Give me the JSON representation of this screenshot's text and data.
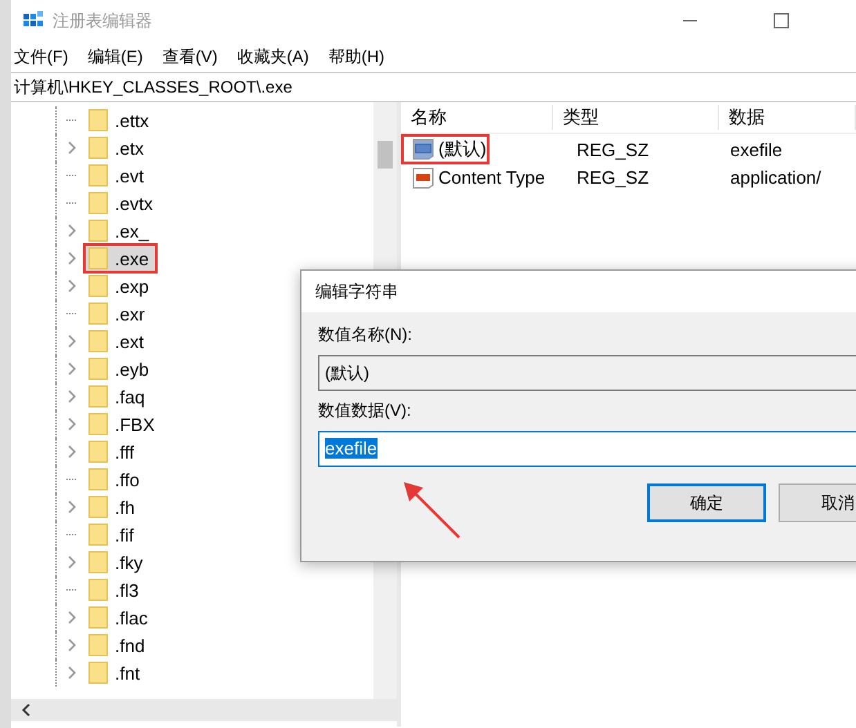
{
  "window": {
    "title": "注册表编辑器",
    "active": false
  },
  "menu": [
    "文件(F)",
    "编辑(E)",
    "查看(V)",
    "收藏夹(A)",
    "帮助(H)"
  ],
  "address": "计算机\\HKEY_CLASSES_ROOT\\.exe",
  "tree": [
    {
      "label": ".ettx",
      "expandable": false,
      "selected": false,
      "marked": false
    },
    {
      "label": ".etx",
      "expandable": true,
      "selected": false,
      "marked": false
    },
    {
      "label": ".evt",
      "expandable": false,
      "selected": false,
      "marked": false
    },
    {
      "label": ".evtx",
      "expandable": false,
      "selected": false,
      "marked": false
    },
    {
      "label": ".ex_",
      "expandable": true,
      "selected": false,
      "marked": false
    },
    {
      "label": ".exe",
      "expandable": true,
      "selected": true,
      "marked": true
    },
    {
      "label": ".exp",
      "expandable": true,
      "selected": false,
      "marked": false
    },
    {
      "label": ".exr",
      "expandable": false,
      "selected": false,
      "marked": false
    },
    {
      "label": ".ext",
      "expandable": true,
      "selected": false,
      "marked": false
    },
    {
      "label": ".eyb",
      "expandable": true,
      "selected": false,
      "marked": false
    },
    {
      "label": ".faq",
      "expandable": true,
      "selected": false,
      "marked": false
    },
    {
      "label": ".FBX",
      "expandable": true,
      "selected": false,
      "marked": false
    },
    {
      "label": ".fff",
      "expandable": true,
      "selected": false,
      "marked": false
    },
    {
      "label": ".ffo",
      "expandable": false,
      "selected": false,
      "marked": false
    },
    {
      "label": ".fh",
      "expandable": true,
      "selected": false,
      "marked": false
    },
    {
      "label": ".fif",
      "expandable": false,
      "selected": false,
      "marked": false
    },
    {
      "label": ".fky",
      "expandable": true,
      "selected": false,
      "marked": false
    },
    {
      "label": ".fl3",
      "expandable": false,
      "selected": false,
      "marked": false
    },
    {
      "label": ".flac",
      "expandable": true,
      "selected": false,
      "marked": false
    },
    {
      "label": ".fnd",
      "expandable": true,
      "selected": false,
      "marked": false
    },
    {
      "label": ".fnt",
      "expandable": true,
      "selected": false,
      "marked": false
    }
  ],
  "values": {
    "columns": [
      "名称",
      "类型",
      "数据"
    ],
    "rows": [
      {
        "name": "(默认)",
        "type": "REG_SZ",
        "data": "exefile",
        "marked": true
      },
      {
        "name": "Content Type",
        "type": "REG_SZ",
        "data": "application/",
        "marked": false
      }
    ]
  },
  "dialog": {
    "title": "编辑字符串",
    "name_label": "数值名称(N):",
    "name_value": "(默认)",
    "data_label": "数值数据(V):",
    "data_value": "exefile",
    "data_selected": true,
    "buttons": [
      {
        "label": "确定",
        "default": true
      },
      {
        "label": "取消",
        "default": false
      }
    ]
  }
}
